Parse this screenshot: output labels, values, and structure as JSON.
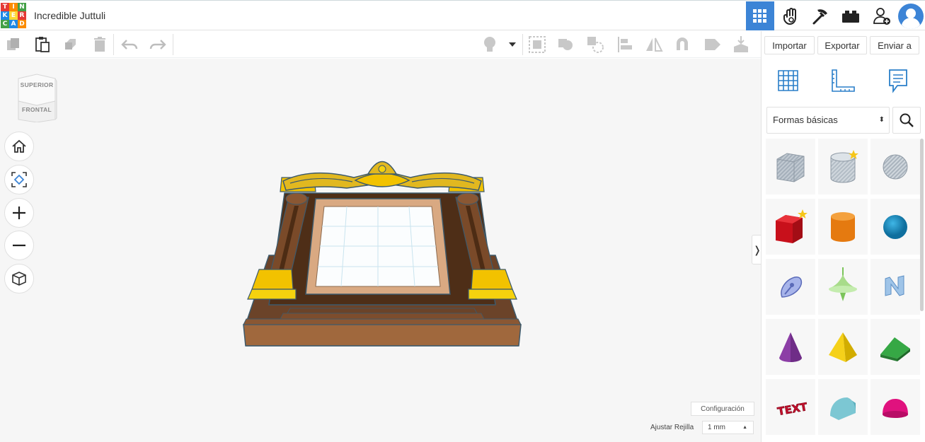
{
  "app": {
    "title": "Incredible Juttuli",
    "logo_letters": [
      "T",
      "I",
      "N",
      "K",
      "E",
      "R",
      "C",
      "A",
      "D"
    ],
    "logo_colors": [
      "#e53935",
      "#fb8c00",
      "#43a047",
      "#1e88e5",
      "#fdd835",
      "#e53935",
      "#43a047",
      "#1e88e5",
      "#fb8c00"
    ]
  },
  "header": {
    "icons": [
      {
        "name": "grid-view-icon",
        "active": true
      },
      {
        "name": "hand-wave-icon",
        "active": false
      },
      {
        "name": "pickaxe-icon",
        "active": false
      },
      {
        "name": "bricks-icon",
        "active": false
      },
      {
        "name": "add-user-icon",
        "active": false
      },
      {
        "name": "avatar",
        "active": false
      }
    ],
    "accent": "#3c84d6"
  },
  "toolbar": {
    "tools": [
      "copy-icon",
      "paste-icon",
      "duplicate-icon",
      "delete-icon",
      "undo-icon",
      "redo-icon"
    ],
    "view_tools": [
      "light-bulb-icon",
      "dropdown-caret-icon",
      "group-icon",
      "ungroup-icon",
      "hole-icon",
      "align-icon",
      "mirror-icon",
      "magnet-icon",
      "note-icon",
      "drop-icon"
    ]
  },
  "panel": {
    "import_label": "Importar",
    "export_label": "Exportar",
    "send_label": "Enviar a",
    "view_icons": [
      "workplane-icon",
      "ruler-icon",
      "notes-icon"
    ],
    "shape_category": "Formas básicas",
    "shapes": [
      {
        "name": "box-hole-shape",
        "color": "#a9b4bf"
      },
      {
        "name": "cylinder-hole-shape",
        "color": "#b9c2ca",
        "starred": true
      },
      {
        "name": "sphere-hole-shape",
        "color": "#b9c2ca"
      },
      {
        "name": "box-shape",
        "color": "#e01b24",
        "starred": true
      },
      {
        "name": "cylinder-shape",
        "color": "#f28c1c"
      },
      {
        "name": "sphere-shape",
        "color": "#1a90c8"
      },
      {
        "name": "scribble-shape",
        "color": "#7c8fd6"
      },
      {
        "name": "paraboloid-shape",
        "color": "#9bd36b"
      },
      {
        "name": "text-n-shape",
        "color": "#7fa8d6"
      },
      {
        "name": "cone-shape",
        "color": "#8e3fa6"
      },
      {
        "name": "pyramid-shape",
        "color": "#f2c800"
      },
      {
        "name": "wedge-shape",
        "color": "#2e9b3a"
      },
      {
        "name": "text-shape",
        "color": "#c8102e"
      },
      {
        "name": "half-cylinder-shape",
        "color": "#5bc0d0"
      },
      {
        "name": "half-sphere-shape",
        "color": "#e0127e"
      }
    ]
  },
  "workplane": {
    "viewcube_top": "SUPERIOR",
    "viewcube_front": "FRONTAL",
    "nav": [
      "home-icon",
      "fit-view-icon",
      "zoom-in-icon",
      "zoom-out-icon",
      "perspective-icon"
    ],
    "settings_label": "Configuración",
    "snap_label": "Ajustar Rejilla",
    "snap_value": "1 mm"
  }
}
